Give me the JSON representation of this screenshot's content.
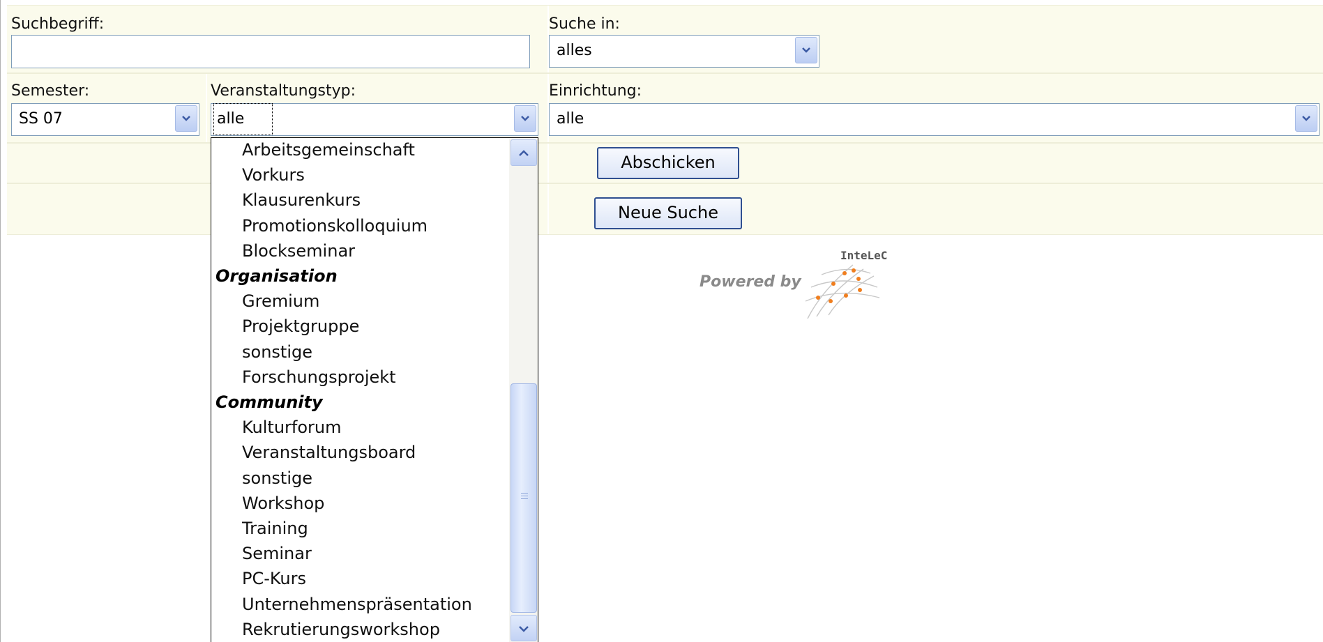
{
  "search": {
    "label": "Suchbegriff:",
    "value": ""
  },
  "search_in": {
    "label": "Suche in:",
    "value": "alles"
  },
  "semester": {
    "label": "Semester:",
    "value": "SS 07"
  },
  "event_type": {
    "label": "Veranstaltungstyp:",
    "value": "alle",
    "options": [
      {
        "text": "Arbeitsgemeinschaft",
        "group": false
      },
      {
        "text": "Vorkurs",
        "group": false
      },
      {
        "text": "Klausurenkurs",
        "group": false
      },
      {
        "text": "Promotionskolloquium",
        "group": false
      },
      {
        "text": "Blockseminar",
        "group": false
      },
      {
        "text": "Organisation",
        "group": true
      },
      {
        "text": "Gremium",
        "group": false
      },
      {
        "text": "Projektgruppe",
        "group": false
      },
      {
        "text": "sonstige",
        "group": false
      },
      {
        "text": "Forschungsprojekt",
        "group": false
      },
      {
        "text": "Community",
        "group": true
      },
      {
        "text": "Kulturforum",
        "group": false
      },
      {
        "text": "Veranstaltungsboard",
        "group": false
      },
      {
        "text": "sonstige",
        "group": false
      },
      {
        "text": "Workshop",
        "group": false
      },
      {
        "text": "Training",
        "group": false
      },
      {
        "text": "Seminar",
        "group": false
      },
      {
        "text": "PC-Kurs",
        "group": false
      },
      {
        "text": "Unternehmenspräsentation",
        "group": false
      },
      {
        "text": "Rekrutierungsworkshop",
        "group": false
      }
    ]
  },
  "institution": {
    "label": "Einrichtung:",
    "value": "alle"
  },
  "buttons": {
    "submit": "Abschicken",
    "new_search": "Neue Suche"
  },
  "footer_logo": {
    "powered_by": "Powered by",
    "brand": "InteLeC"
  },
  "colors": {
    "form_bg": "#fbfbec",
    "button_border": "#2f4f90",
    "logo_orange": "#f07e1e"
  }
}
